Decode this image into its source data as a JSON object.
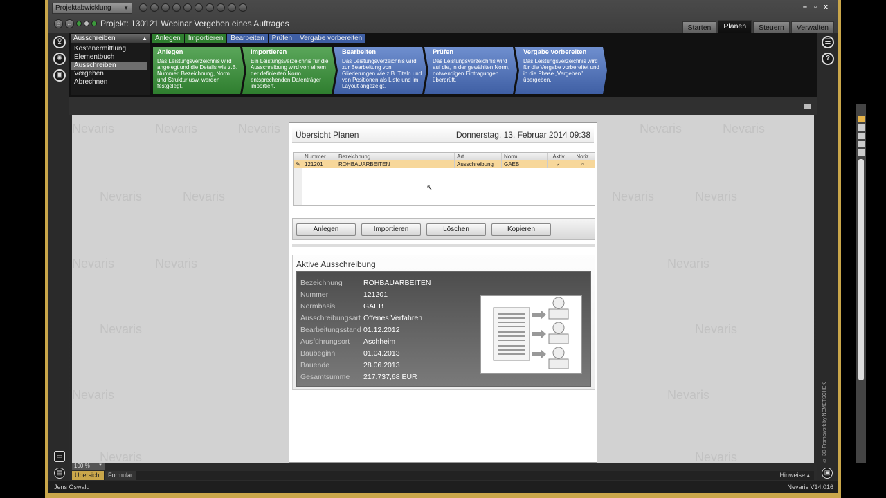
{
  "titlebar": {
    "module": "Projektabwicklung",
    "project_title": "Projekt: 130121 Webinar Vergeben eines Auftrages",
    "window_controls": [
      "–",
      "▫",
      "x"
    ]
  },
  "main_tabs": [
    "Starten",
    "Planen",
    "Steuern",
    "Verwalten"
  ],
  "active_main_tab": "Planen",
  "stages": {
    "header": "Ausschreiben",
    "items": [
      "Kostenermittlung",
      "Elementbuch",
      "Ausschreiben",
      "Vergeben",
      "Abrechnen"
    ],
    "active": "Ausschreiben"
  },
  "step_tabs": [
    "Anlegen",
    "Importieren",
    "Bearbeiten",
    "Prüfen",
    "Vergabe vorbereiten"
  ],
  "steps": [
    {
      "title": "Anlegen",
      "text": "Das Leistungsverzeichnis wird angelegt und die Details wie z.B. Nummer, Bezeichnung, Norm und Struktur usw. werden festgelegt.",
      "color": "green"
    },
    {
      "title": "Importieren",
      "text": "Ein Leistungsverzeichnis für die Ausschreibung wird von einem der definierten Norm entsprechenden Datenträger importiert.",
      "color": "green"
    },
    {
      "title": "Bearbeiten",
      "text": "Das Leistungsverzeichnis wird zur Bearbeitung von Gliederungen wie z.B. Titeln und von Positionen als Liste und im Layout angezeigt.",
      "color": "blue"
    },
    {
      "title": "Prüfen",
      "text": "Das Leistungsverzeichnis wird auf die, in der gewählten Norm, notwendigen Eintragungen überprüft.",
      "color": "blue"
    },
    {
      "title": "Vergabe vorbereiten",
      "text": "Das Leistungsverzeichnis wird für die Vergabe vorbereitet und in die Phase „Vergeben\" übergeben.",
      "color": "blue"
    }
  ],
  "panel": {
    "title": "Übersicht Planen",
    "date": "Donnerstag, 13. Februar 2014 09:38",
    "grid": {
      "columns": [
        "Nummer",
        "Bezeichnung",
        "Art",
        "Norm",
        "Aktiv",
        "Notiz"
      ],
      "rows": [
        {
          "nummer": "121201",
          "bezeichnung": "ROHBAUARBEITEN",
          "art": "Ausschreibung",
          "norm": "GAEB",
          "aktiv": "✓",
          "notiz": ""
        }
      ]
    },
    "buttons": [
      "Anlegen",
      "Importieren",
      "Löschen",
      "Kopieren"
    ],
    "active_section": {
      "title": "Aktive Ausschreibung",
      "fields": [
        {
          "label": "Bezeichnung",
          "value": "ROHBAUARBEITEN"
        },
        {
          "label": "Nummer",
          "value": "121201"
        },
        {
          "label": "Normbasis",
          "value": "GAEB"
        },
        {
          "label": "Ausschreibungsart",
          "value": "Offenes Verfahren"
        },
        {
          "label": "Bearbeitungsstand",
          "value": "01.12.2012"
        },
        {
          "label": "Ausführungsort",
          "value": "Aschheim"
        },
        {
          "label": "Baubeginn",
          "value": "01.04.2013"
        },
        {
          "label": "Bauende",
          "value": "28.06.2013"
        },
        {
          "label": "Gesamtsumme",
          "value": "217.737,68 EUR"
        }
      ]
    }
  },
  "watermark": "Nevaris",
  "footer": {
    "zoom": "100 %",
    "tabs": [
      "Übersicht",
      "Formular"
    ],
    "hints": "Hinweise",
    "user": "Jens Oswald",
    "version": "Nevaris V14.016",
    "brand_vertical": "© 3D-Framework by NEMETSCHEK"
  },
  "colors": {
    "frame": "#c9a64a",
    "step_green": "#3f8f3f",
    "step_blue": "#4f6fb4",
    "selected_row": "#f7d79a"
  }
}
